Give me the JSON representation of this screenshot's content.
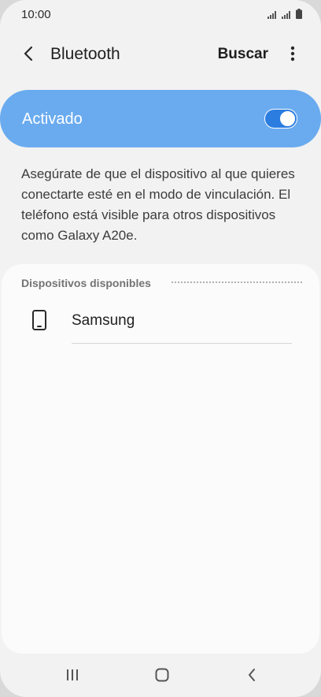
{
  "status_bar": {
    "time": "10:00",
    "signal_icon_1": "signal-icon",
    "signal_icon_2": "signal-icon",
    "battery_icon": "battery-icon"
  },
  "header": {
    "title": "Bluetooth",
    "search_label": "Buscar",
    "back_icon": "back-arrow-icon",
    "more_icon": "more-vertical-icon"
  },
  "master_switch": {
    "label": "Activado",
    "state": "on"
  },
  "description": "Asegúrate de que el dispositivo al que quieres conectarte esté en el modo de vinculación. El teléfono está visible para otros dispositivos como Galaxy A20e.",
  "available_devices": {
    "header": "Dispositivos disponibles",
    "items": [
      {
        "name": "Samsung",
        "icon": "phone-icon"
      }
    ]
  },
  "nav_bar": {
    "recents_icon": "recents-icon",
    "home_icon": "home-icon",
    "back_icon": "back-icon"
  },
  "colors": {
    "accent": "#6aabef",
    "toggle": "#2b7de0",
    "background": "#f2f2f2",
    "card": "#fbfbfb"
  }
}
